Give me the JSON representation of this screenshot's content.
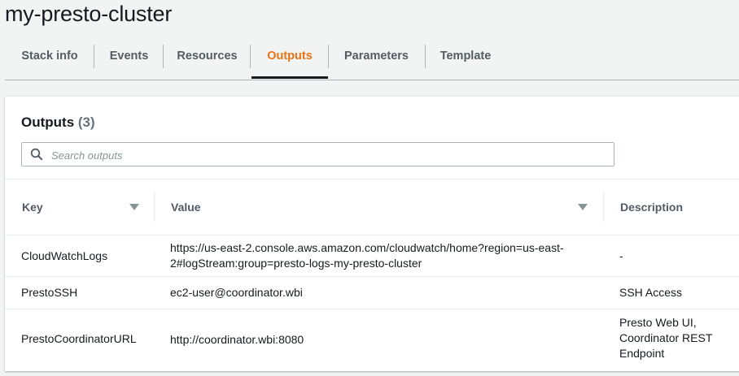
{
  "page": {
    "title": "my-presto-cluster"
  },
  "tabs": [
    {
      "label": "Stack info"
    },
    {
      "label": "Events"
    },
    {
      "label": "Resources"
    },
    {
      "label": "Outputs",
      "active": true
    },
    {
      "label": "Parameters"
    },
    {
      "label": "Template"
    }
  ],
  "outputs": {
    "title": "Outputs",
    "count": "(3)",
    "search_placeholder": "Search outputs",
    "columns": {
      "key": "Key",
      "value": "Value",
      "description": "Description"
    },
    "rows": [
      {
        "key": "CloudWatchLogs",
        "value_line1": "https://us-east-2.console.aws.amazon.com/cloudwatch/home?region=us-east-",
        "value_line2": "2#logStream:group=presto-logs-my-presto-cluster",
        "description": "-"
      },
      {
        "key": "PrestoSSH",
        "value": "ec2-user@coordinator.wbi",
        "description": "SSH Access"
      },
      {
        "key": "PrestoCoordinatorURL",
        "value": "http://coordinator.wbi:8080",
        "desc_line1": "Presto Web UI,",
        "desc_line2": "Coordinator REST",
        "desc_line3": "Endpoint"
      }
    ]
  },
  "colors": {
    "active_tab": "#ec7211",
    "text": "#16191f",
    "muted": "#545b64"
  }
}
